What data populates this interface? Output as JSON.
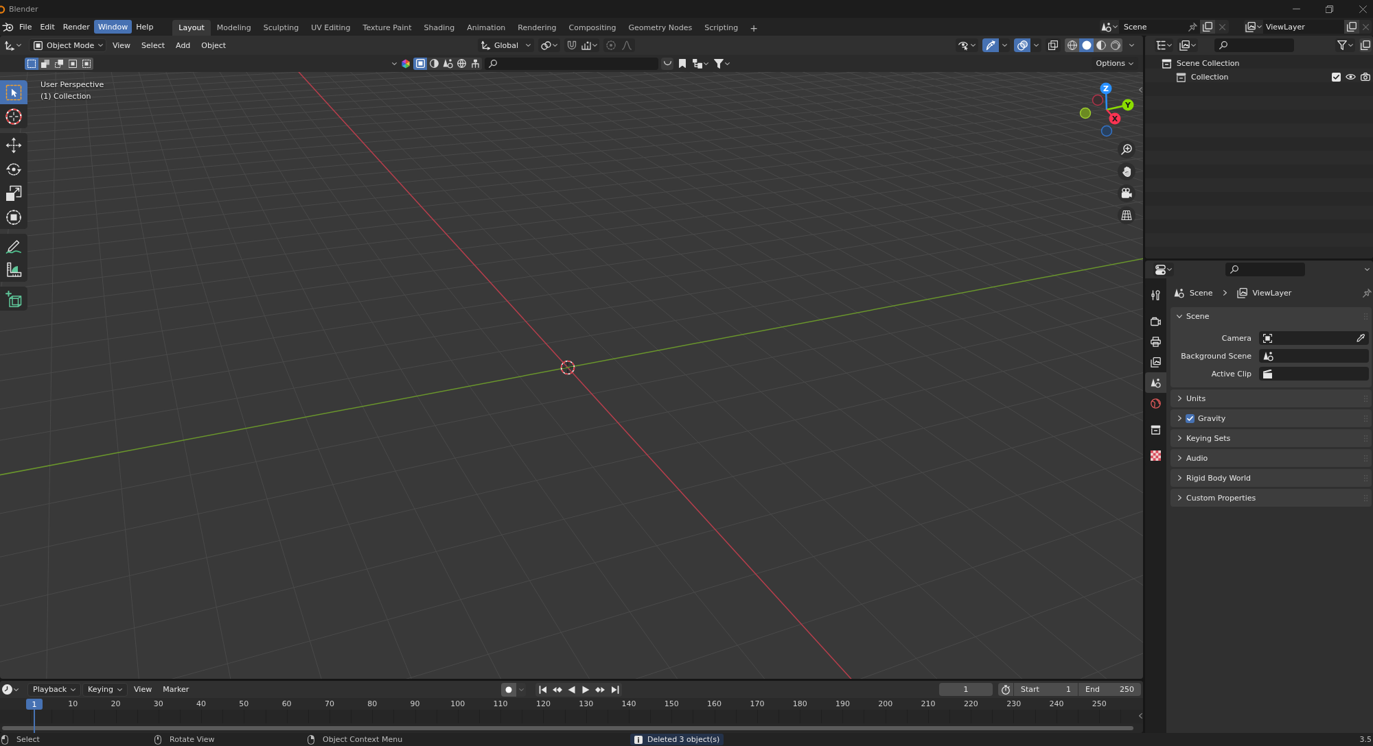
{
  "window": {
    "title": "Blender"
  },
  "menu_bar": [
    {
      "label": "File",
      "selected": false
    },
    {
      "label": "Edit",
      "selected": false
    },
    {
      "label": "Render",
      "selected": false
    },
    {
      "label": "Window",
      "selected": true
    },
    {
      "label": "Help",
      "selected": false
    }
  ],
  "workspace_tabs": [
    {
      "label": "Layout",
      "selected": true
    },
    {
      "label": "Modeling",
      "selected": false
    },
    {
      "label": "Sculpting",
      "selected": false
    },
    {
      "label": "UV Editing",
      "selected": false
    },
    {
      "label": "Texture Paint",
      "selected": false
    },
    {
      "label": "Shading",
      "selected": false
    },
    {
      "label": "Animation",
      "selected": false
    },
    {
      "label": "Rendering",
      "selected": false
    },
    {
      "label": "Compositing",
      "selected": false
    },
    {
      "label": "Geometry Nodes",
      "selected": false
    },
    {
      "label": "Scripting",
      "selected": false
    }
  ],
  "add_workspace": "+",
  "scene_selector": {
    "value": "Scene"
  },
  "view_layer_selector": {
    "value": "ViewLayer"
  },
  "viewport": {
    "header": {
      "mode": "Object Mode",
      "menus": [
        "View",
        "Select",
        "Add",
        "Object"
      ],
      "orientation": "Global",
      "show_gizmos": true,
      "show_overlays": true,
      "xray": false,
      "shading": [
        {
          "kind": "wireframe",
          "selected": false
        },
        {
          "kind": "solid",
          "selected": true
        },
        {
          "kind": "material",
          "selected": false
        },
        {
          "kind": "rendered",
          "selected": false
        }
      ]
    },
    "tool_settings": {
      "select_modes": [
        {
          "kind": "set",
          "selected": true
        },
        {
          "kind": "extend",
          "selected": false
        },
        {
          "kind": "subtract",
          "selected": false
        },
        {
          "kind": "invert",
          "selected": false
        },
        {
          "kind": "intersect",
          "selected": false
        }
      ],
      "filters": [
        {
          "kind": "object",
          "selected": true
        },
        {
          "kind": "sphere",
          "selected": false
        },
        {
          "kind": "shapes",
          "selected": false
        },
        {
          "kind": "world",
          "selected": false
        },
        {
          "kind": "figure",
          "selected": false
        }
      ],
      "options": "Options"
    },
    "toolbar_groups": [
      {
        "tools": [
          {
            "kind": "select-box",
            "selected": true
          },
          {
            "kind": "cursor",
            "selected": false
          }
        ]
      },
      {
        "tools": [
          {
            "kind": "move",
            "selected": false
          },
          {
            "kind": "rotate",
            "selected": false
          },
          {
            "kind": "scale",
            "selected": false
          },
          {
            "kind": "transform",
            "selected": false
          }
        ]
      },
      {
        "tools": [
          {
            "kind": "annotate",
            "selected": false
          },
          {
            "kind": "measure",
            "selected": false
          }
        ]
      },
      {
        "tools": [
          {
            "kind": "add-cube",
            "selected": false
          }
        ]
      }
    ],
    "overlay_text": [
      "User Perspective",
      "(1) Collection"
    ],
    "gizmo_axes": [
      {
        "kind": "z",
        "label": "Z"
      },
      {
        "kind": "y",
        "label": "Y"
      },
      {
        "kind": "x",
        "label": "X"
      }
    ]
  },
  "outliner": {
    "tree": [
      {
        "label": "Scene Collection",
        "children": [
          {
            "label": "Collection",
            "checked": true
          }
        ]
      }
    ]
  },
  "properties": {
    "tab_groups": [
      {
        "tabs": [
          {
            "kind": "tool",
            "selected": false
          }
        ]
      },
      {
        "tabs": [
          {
            "kind": "render",
            "selected": false
          },
          {
            "kind": "output",
            "selected": false
          },
          {
            "kind": "view-layer",
            "selected": false
          },
          {
            "kind": "scene",
            "selected": true
          },
          {
            "kind": "world",
            "selected": false
          }
        ]
      },
      {
        "tabs": [
          {
            "kind": "collection",
            "selected": false
          }
        ]
      },
      {
        "tabs": [
          {
            "kind": "texture",
            "selected": false
          }
        ]
      }
    ],
    "breadcrumb": [
      {
        "kind": "scene",
        "label": "Scene"
      },
      {
        "kind": "view-layer",
        "label": "ViewLayer"
      }
    ],
    "panels": [
      {
        "title": "Scene",
        "expanded": true,
        "fields": [
          {
            "kind": "camera",
            "label": "Camera"
          },
          {
            "kind": "scene",
            "label": "Background Scene"
          },
          {
            "kind": "clip",
            "label": "Active Clip"
          }
        ]
      },
      {
        "title": "Units",
        "expanded": false
      },
      {
        "title": "Gravity",
        "expanded": false,
        "checked": true
      },
      {
        "title": "Keying Sets",
        "expanded": false
      },
      {
        "title": "Audio",
        "expanded": false
      },
      {
        "title": "Rigid Body World",
        "expanded": false
      },
      {
        "title": "Custom Properties",
        "expanded": false
      }
    ]
  },
  "timeline": {
    "menus": [
      {
        "kind": "dropdown",
        "label": "Playback"
      },
      {
        "kind": "dropdown",
        "label": "Keying"
      },
      {
        "kind": "menu",
        "label": "View"
      },
      {
        "kind": "menu",
        "label": "Marker"
      }
    ],
    "auto_keying": false,
    "current_frame": "1",
    "start_label": "Start",
    "start": "1",
    "end_label": "End",
    "end": "250",
    "playhead": "1",
    "ruler": [
      "10",
      "20",
      "30",
      "40",
      "50",
      "60",
      "70",
      "80",
      "90",
      "100",
      "110",
      "120",
      "130",
      "140",
      "150",
      "160",
      "170",
      "180",
      "190",
      "200",
      "210",
      "220",
      "230",
      "240",
      "250"
    ]
  },
  "status_bar": {
    "hints": [
      {
        "kind": "left-click",
        "label": "Select"
      },
      {
        "kind": "middle-click",
        "label": "Rotate View"
      },
      {
        "kind": "right-click",
        "label": "Object Context Menu"
      }
    ],
    "report": "Deleted 3 object(s)",
    "version": "3.5"
  }
}
